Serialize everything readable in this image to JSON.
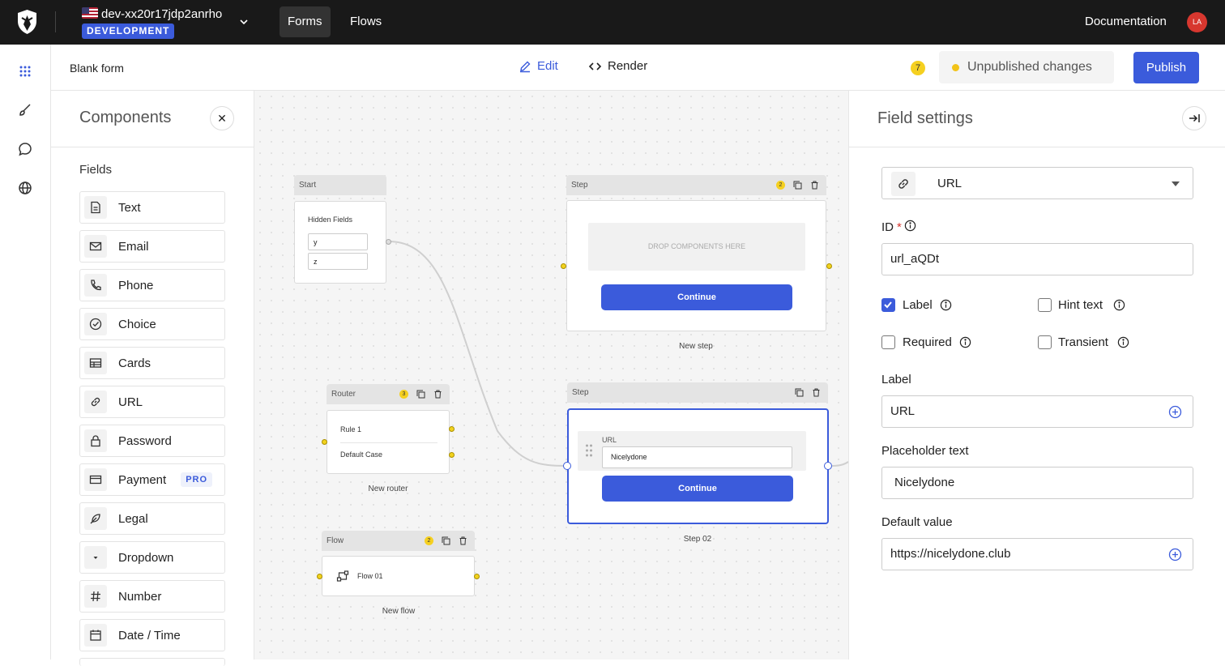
{
  "topbar": {
    "tenant_name": "dev-xx20r17jdp2anrho",
    "env_badge": "DEVELOPMENT",
    "nav": [
      {
        "label": "Forms",
        "active": true
      },
      {
        "label": "Flows",
        "active": false
      }
    ],
    "documentation": "Documentation",
    "avatar_initials": "LA"
  },
  "subheader": {
    "form_title": "Blank form",
    "edit_label": "Edit",
    "render_label": "Render",
    "notification_count": "7",
    "status_text": "Unpublished changes",
    "publish_label": "Publish"
  },
  "components": {
    "title": "Components",
    "section_label": "Fields",
    "items": [
      {
        "label": "Text",
        "icon": "document-icon"
      },
      {
        "label": "Email",
        "icon": "mail-icon"
      },
      {
        "label": "Phone",
        "icon": "phone-icon"
      },
      {
        "label": "Choice",
        "icon": "check-circle-icon"
      },
      {
        "label": "Cards",
        "icon": "cards-icon"
      },
      {
        "label": "URL",
        "icon": "link-icon"
      },
      {
        "label": "Password",
        "icon": "lock-icon"
      },
      {
        "label": "Payment",
        "icon": "credit-card-icon",
        "badge": "PRO"
      },
      {
        "label": "Legal",
        "icon": "feather-icon"
      },
      {
        "label": "Dropdown",
        "icon": "caret-down-icon"
      },
      {
        "label": "Number",
        "icon": "hash-icon"
      },
      {
        "label": "Date / Time",
        "icon": "calendar-icon"
      }
    ]
  },
  "canvas": {
    "start": {
      "header": "Start",
      "title": "Hidden Fields",
      "fields": [
        "y",
        "z"
      ]
    },
    "step1": {
      "header": "Step",
      "badge": "2",
      "drop_text": "DROP COMPONENTS HERE",
      "button": "Continue",
      "caption": "New step"
    },
    "router": {
      "header": "Router",
      "badge": "3",
      "rule": "Rule 1",
      "default_case": "Default Case",
      "caption": "New router"
    },
    "step2": {
      "header": "Step",
      "field_label": "URL",
      "field_value": "Nicelydone",
      "button": "Continue",
      "caption": "Step 02"
    },
    "flow": {
      "header": "Flow",
      "badge": "2",
      "flow_name": "Flow 01",
      "caption": "New flow"
    }
  },
  "settings": {
    "title": "Field settings",
    "type_value": "URL",
    "id_label": "ID",
    "id_required_mark": "*",
    "id_value": "url_aQDt",
    "checkboxes": {
      "label": {
        "text": "Label",
        "checked": true
      },
      "hint_text": {
        "text": "Hint text",
        "checked": false
      },
      "required": {
        "text": "Required",
        "checked": false
      },
      "transient": {
        "text": "Transient",
        "checked": false
      }
    },
    "label_field_label": "Label",
    "label_value": "URL",
    "placeholder_label": "Placeholder text",
    "placeholder_value": "Nicelydone",
    "default_label": "Default value",
    "default_value": "https://nicelydone.club"
  },
  "colors": {
    "accent": "#3b5bdb",
    "topbar_bg": "#191919",
    "status_dot": "#f2c318",
    "avatar_bg": "#d7372f"
  }
}
